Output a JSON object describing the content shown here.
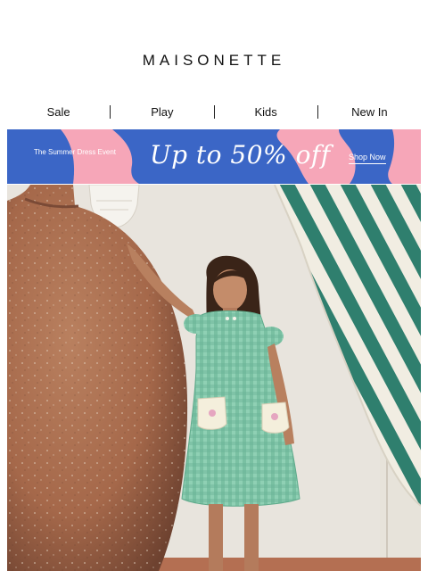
{
  "brand": {
    "logo": "MAISONETTE"
  },
  "nav": {
    "items": [
      {
        "label": "Sale"
      },
      {
        "label": "Play"
      },
      {
        "label": "Kids"
      },
      {
        "label": "New In"
      }
    ]
  },
  "banner": {
    "event_text": "The Summer Dress Event",
    "headline": "Up to 50% off",
    "cta": "Shop Now",
    "colors": {
      "pink": "#f6a6b8",
      "blue": "#3b66c6"
    }
  },
  "hero": {
    "colors": {
      "wall": "#ece9e2",
      "urn": "#a5684a",
      "dress": "#7fc4a8",
      "awning": "#2f7f6e"
    }
  }
}
